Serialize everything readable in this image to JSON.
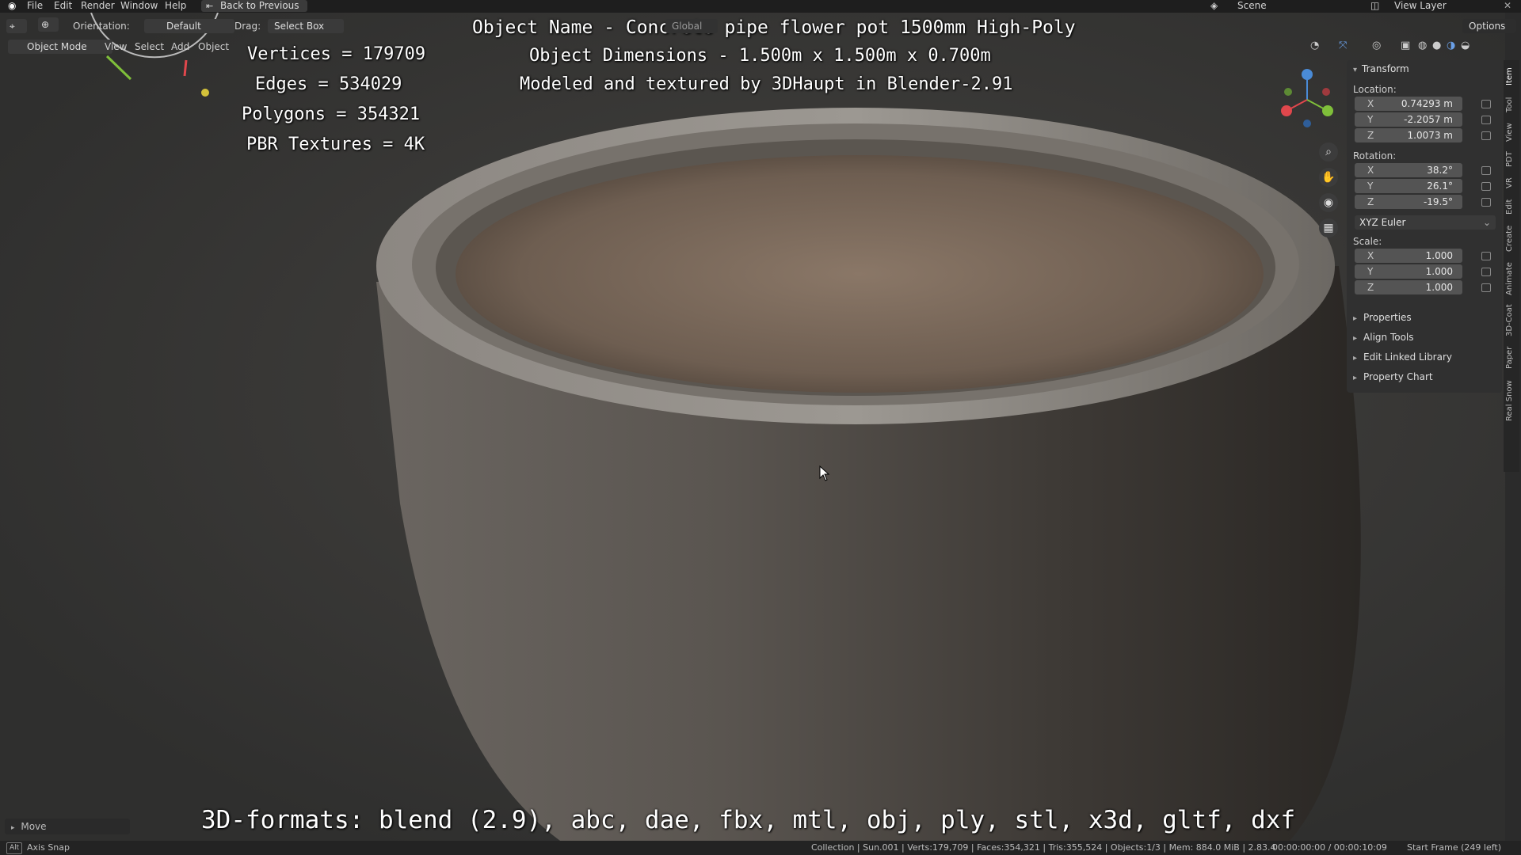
{
  "menu": {
    "items": [
      "File",
      "Edit",
      "Render",
      "Window",
      "Help"
    ],
    "back_label": "Back to Previous",
    "scene_label": "Scene",
    "view_layer_label": "View Layer"
  },
  "header": {
    "orientation_label": "Orientation:",
    "orientation_value": "Default",
    "drag_label": "Drag:",
    "drag_value": "Select Box",
    "transform_space": "Global",
    "options_label": "Options",
    "mode_label": "Object Mode",
    "view_menu": "View",
    "select_menu": "Select",
    "add_menu": "Add",
    "object_menu": "Object"
  },
  "overlay": {
    "title": "Object Name - Concrete pipe flower pot 1500mm High-Poly",
    "dimensions": "Object Dimensions -  1.500m x 1.500m x 0.700m",
    "credit": "Modeled and textured by 3DHaupt in Blender-2.91",
    "vertices": "Vertices = 179709",
    "edges": "Edges = 534029",
    "polygons": "Polygons = 354321",
    "textures": "PBR Textures = 4K",
    "formats": "3D-formats: blend (2.9), abc, dae, fbx, mtl, obj, ply, stl, x3d, gltf, dxf"
  },
  "npanel": {
    "transform_label": "Transform",
    "location_label": "Location:",
    "location": {
      "x": "0.74293 m",
      "y": "-2.2057 m",
      "z": "1.0073 m"
    },
    "rotation_label": "Rotation:",
    "rotation": {
      "x": "38.2°",
      "y": "26.1°",
      "z": "-19.5°"
    },
    "rotation_mode": "XYZ Euler",
    "scale_label": "Scale:",
    "scale": {
      "x": "1.000",
      "y": "1.000",
      "z": "1.000"
    },
    "axis_x": "X",
    "axis_y": "Y",
    "axis_z": "Z",
    "sections": [
      "Properties",
      "Align Tools",
      "Edit Linked Library",
      "Property Chart"
    ]
  },
  "tabs": [
    "Item",
    "Tool",
    "View",
    "PDT",
    "VR",
    "Edit",
    "Create",
    "Animate",
    "3D-Coat",
    "Paper",
    "Real Snow"
  ],
  "operator_panel": {
    "label": "Move"
  },
  "statusbar": {
    "key_label": "Alt",
    "left_text": "Axis Snap",
    "stats": "Collection | Sun.001 | Verts:179,709 | Faces:354,321 | Tris:355,524 | Objects:1/3 | Mem: 884.0 MiB | 2.83.4",
    "time": "00:00:00:00 / 00:00:10:09",
    "frame": "Start Frame (249 left)"
  },
  "colors": {
    "axis_x": "#e0474c",
    "axis_y": "#7fbf3a",
    "axis_z": "#4a8bd6",
    "accent": "#4772b3"
  }
}
